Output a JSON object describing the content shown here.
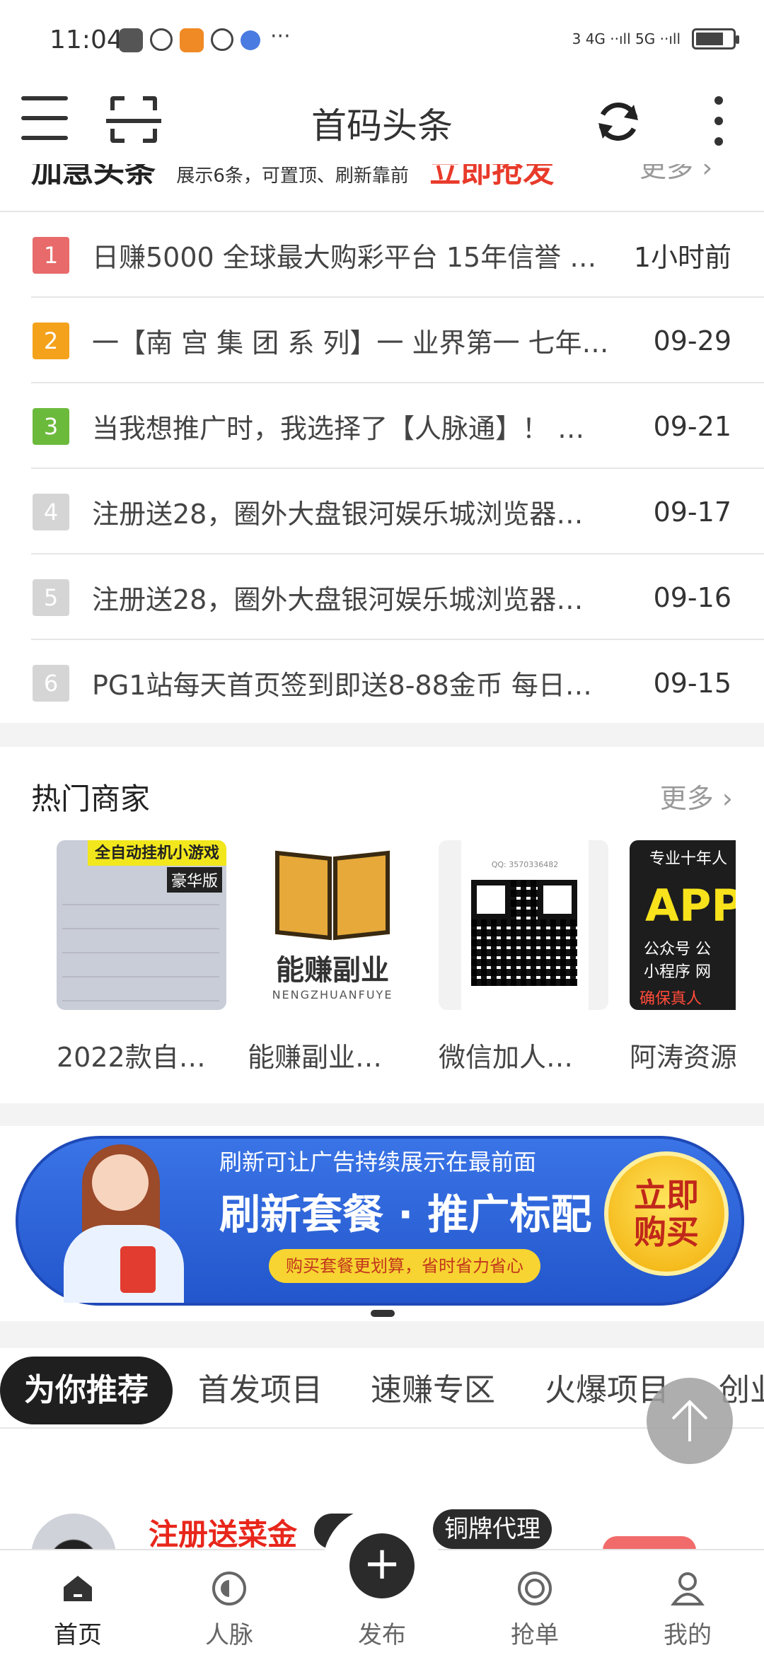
{
  "status_bar": {
    "time": "11:04",
    "signal_text": "3 4G ··ıll 5G ··ıll",
    "dots": "···"
  },
  "app_bar": {
    "title": "首码头条",
    "icons": [
      "menu-icon",
      "scan-icon",
      "refresh-icon",
      "more-vert-icon"
    ]
  },
  "news": {
    "header_partial": {
      "title": "加急头条",
      "subtitle": "展示6条，可置顶、刷新靠前",
      "cta": "立即抢发",
      "more": "更多 ›"
    },
    "items": [
      {
        "rank": "1",
        "title": "日赚5000 全球最大购彩平台 15年信誉 …",
        "time": "1小时前"
      },
      {
        "rank": "2",
        "title": "一【南 宫 集 团 系 列】一 业界第一 七年…",
        "time": "09-29"
      },
      {
        "rank": "3",
        "title": "当我想推广时，我选择了【人脉通】！ …",
        "time": "09-21"
      },
      {
        "rank": "4",
        "title": "注册送28，圈外大盘银河娱乐城浏览器…",
        "time": "09-17"
      },
      {
        "rank": "5",
        "title": "注册送28，圈外大盘银河娱乐城浏览器…",
        "time": "09-16"
      },
      {
        "rank": "6",
        "title": "PG1站每天首页签到即送8-88金币 每日…",
        "time": "09-15"
      }
    ]
  },
  "merchants": {
    "title": "热门商家",
    "more": "更多 ›",
    "items": [
      {
        "name": "2022款自…",
        "img_banner": "全自动挂机小游戏",
        "img_tag": "豪华版"
      },
      {
        "name": "能赚副业…",
        "img_text": "能赚副业",
        "img_sub": "NENGZHUANFUYE"
      },
      {
        "name": "微信加人…",
        "img_text": "QQ: 3570336482"
      },
      {
        "name": "阿涛资源",
        "img_t1": "专业十年人",
        "img_t2": "APP推",
        "img_t3": "公众号    公",
        "img_t4": "小程序    网",
        "img_t5": "确保真人"
      }
    ]
  },
  "promo": {
    "top": "刷新可让广告持续展示在最前面",
    "main": "刷新套餐 · 推广标配",
    "sub": "购买套餐更划算，省时省力省心",
    "button_line1": "立即",
    "button_line2": "购买"
  },
  "tabs": [
    {
      "label": "为你推荐",
      "active": true
    },
    {
      "label": "首发项目"
    },
    {
      "label": "速赚专区"
    },
    {
      "label": "火爆项目"
    },
    {
      "label": "创业"
    }
  ],
  "feed": {
    "title": "注册送菜金",
    "badge": "铜牌代理"
  },
  "bottom_nav": [
    {
      "label": "首页",
      "icon": "home-icon",
      "active": true
    },
    {
      "label": "人脉",
      "icon": "contacts-icon"
    },
    {
      "label": "发布",
      "icon": "plus-icon"
    },
    {
      "label": "抢单",
      "icon": "target-icon"
    },
    {
      "label": "我的",
      "icon": "user-icon"
    }
  ]
}
